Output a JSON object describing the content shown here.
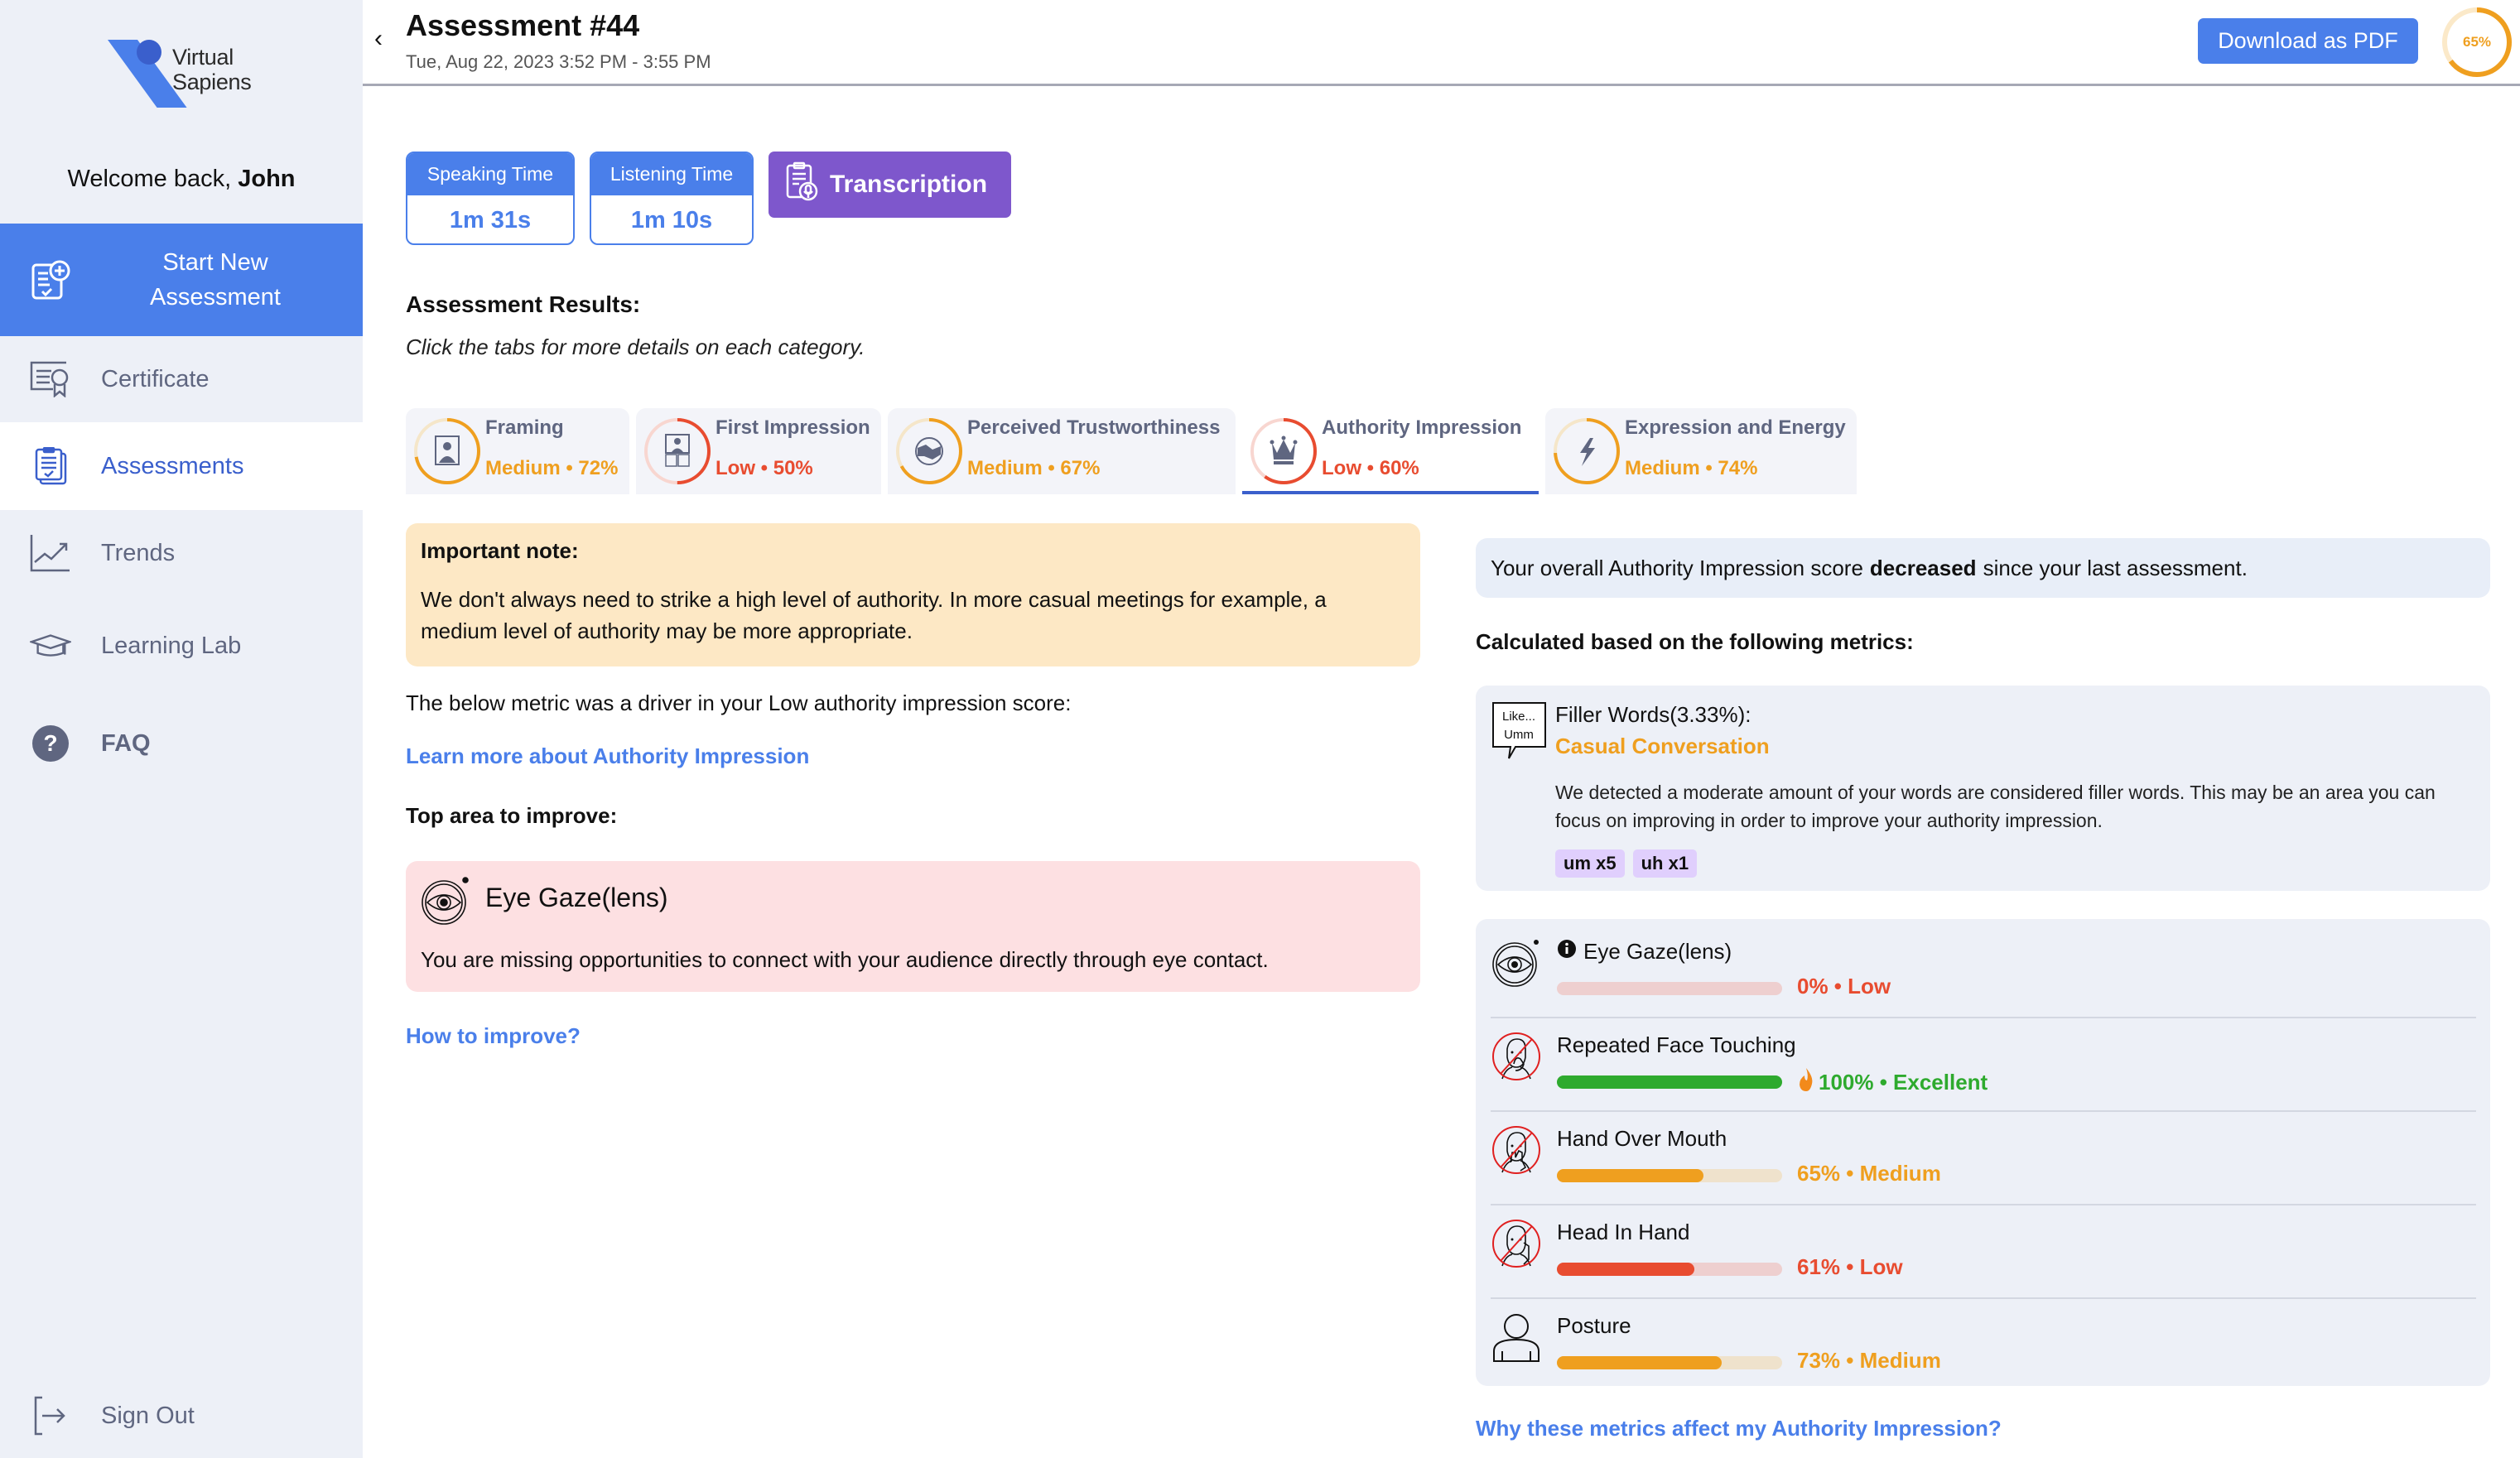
{
  "brand": {
    "line1": "Virtual",
    "line2": "Sapiens"
  },
  "sidebar": {
    "welcome_prefix": "Welcome back, ",
    "user_name": "John",
    "items": [
      {
        "label": "Start New Assessment",
        "icon": "new-assessment-icon"
      },
      {
        "label": "Certificate",
        "icon": "certificate-icon"
      },
      {
        "label": "Assessments",
        "icon": "assessments-icon",
        "active": true
      },
      {
        "label": "Trends",
        "icon": "trends-icon"
      },
      {
        "label": "Learning Lab",
        "icon": "graduation-cap-icon"
      },
      {
        "label": "FAQ",
        "icon": "question-icon"
      }
    ],
    "sign_out": "Sign Out"
  },
  "header": {
    "back_glyph": "‹",
    "title": "Assessment #44",
    "date": "Tue, Aug 22, 2023 3:52 PM - 3:55 PM",
    "download_label": "Download as PDF",
    "overall_score": {
      "value": 65,
      "label": "65%"
    }
  },
  "stats": {
    "speaking": {
      "label": "Speaking Time",
      "value": "1m 31s"
    },
    "listening": {
      "label": "Listening Time",
      "value": "1m 10s"
    },
    "transcription_label": "Transcription"
  },
  "results": {
    "title": "Assessment Results:",
    "subtitle": "Click the tabs for more details on each category."
  },
  "tabs": [
    {
      "name": "Framing",
      "score": "Medium • 72%",
      "value": 72,
      "color": "#ef9f1f",
      "icon": "framing-icon"
    },
    {
      "name": "First Impression",
      "score": "Low • 50%",
      "value": 50,
      "color": "#e84c30",
      "icon": "first-impression-icon"
    },
    {
      "name": "Perceived Trustworthiness",
      "score": "Medium • 67%",
      "value": 67,
      "color": "#ef9f1f",
      "icon": "handshake-icon"
    },
    {
      "name": "Authority Impression",
      "score": "Low • 60%",
      "value": 60,
      "color": "#e84c30",
      "icon": "crown-icon",
      "active": true
    },
    {
      "name": "Expression and Energy",
      "score": "Medium • 74%",
      "value": 74,
      "color": "#ef9f1f",
      "icon": "lightning-icon"
    }
  ],
  "left": {
    "note_title": "Important note:",
    "note_body": "We don't always need to strike a high level of authority. In more casual meetings for example, a medium level of authority may be more appropriate.",
    "driver_text": "The below metric was a driver in your Low authority impression score:",
    "learn_link": "Learn more about Authority Impression",
    "top_area_title": "Top area to improve:",
    "improve_name": "Eye Gaze(lens)",
    "improve_desc": "You are missing opportunities to connect with your audience directly through eye contact.",
    "how_link": "How to improve?"
  },
  "right": {
    "trend_prefix": "Your overall Authority Impression score",
    "trend_word": "decreased",
    "trend_suffix": "since your last assessment.",
    "calc_title": "Calculated based on the following metrics:",
    "filler": {
      "icon_text_1": "Like...",
      "icon_text_2": "Umm",
      "name": "Filler Words(3.33%):",
      "category": "Casual Conversation",
      "desc": "We detected a moderate amount of your words are considered filler words. This may be an area you can focus on improving in order to improve your authority impression.",
      "chips": [
        "um x5",
        "uh x1"
      ]
    },
    "metrics": [
      {
        "name": "Eye Gaze(lens)",
        "value": 0,
        "score": "0% • Low",
        "color": "#e84c30",
        "track": "#eecfcf",
        "info": true,
        "icon": "eye-gaze-icon"
      },
      {
        "name": "Repeated Face Touching",
        "value": 100,
        "score": "100% • Excellent",
        "color": "#2eaa2e",
        "track": "#d4ecd4",
        "flame": true,
        "icon": "no-face-touching-icon"
      },
      {
        "name": "Hand Over Mouth",
        "value": 65,
        "score": "65% • Medium",
        "color": "#ef9f1f",
        "track": "#efe2cc",
        "icon": "no-hand-over-mouth-icon"
      },
      {
        "name": "Head In Hand",
        "value": 61,
        "score": "61% • Low",
        "color": "#e84c30",
        "track": "#eecfcf",
        "icon": "no-head-in-hand-icon"
      },
      {
        "name": "Posture",
        "value": 73,
        "score": "73% • Medium",
        "color": "#ef9f1f",
        "track": "#efe2cc",
        "icon": "posture-icon"
      }
    ],
    "why_link": "Why these metrics affect my Authority Impression?"
  },
  "colors": {
    "accent": "#4a7fea",
    "purple": "#7e57cc",
    "medium": "#ef9f1f",
    "low": "#e84c30",
    "excellent": "#2eaa2e"
  }
}
